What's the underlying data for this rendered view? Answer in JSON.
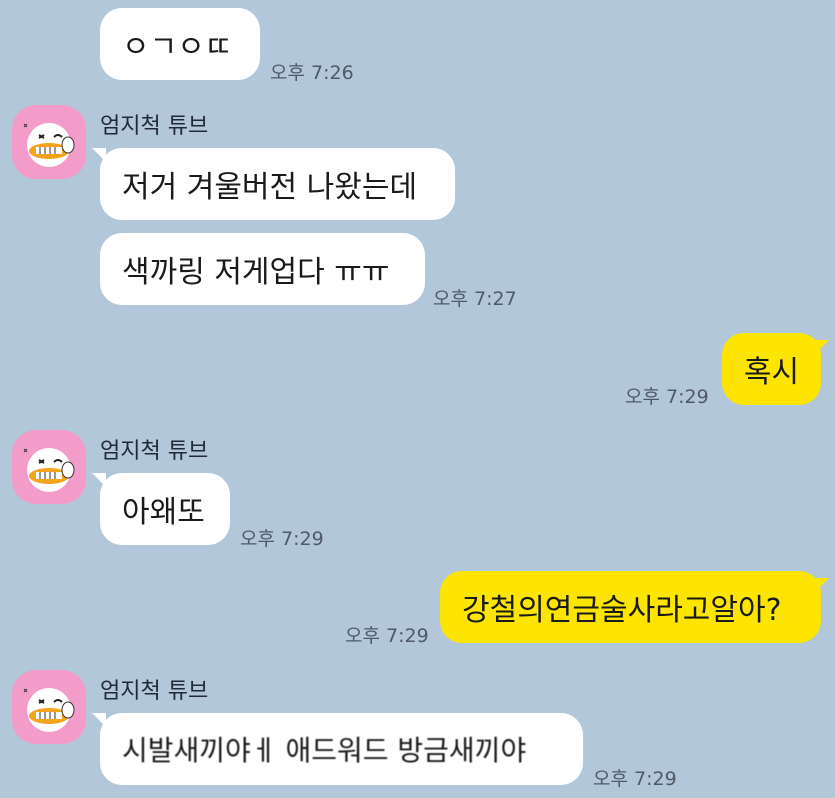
{
  "messages": [
    {
      "text": "ㅇㄱㅇㄸ",
      "time": "오후 7:26"
    },
    {
      "sender": "엄지척 튜브",
      "text": "저거 겨울버전 나왔는데"
    },
    {
      "text": "색까링 저게업다 ㅠㅠ",
      "time": "오후 7:27"
    },
    {
      "text": "혹시",
      "time": "오후 7:29"
    },
    {
      "sender": "엄지척 튜브",
      "text": "아왜또",
      "time": "오후 7:29"
    },
    {
      "text": "강철의연금술사라고알아?",
      "time": "오후 7:29"
    },
    {
      "sender": "엄지척 튜브",
      "text": "시발새끼야ㅔ 애드워드 방금새끼야",
      "time": "오후 7:29"
    }
  ],
  "colors": {
    "background": "#b2c7da",
    "incoming_bubble": "#ffffff",
    "outgoing_bubble": "#fee500",
    "avatar_bg": "#f39cc9"
  },
  "icons": [
    "tube-duck-avatar"
  ]
}
